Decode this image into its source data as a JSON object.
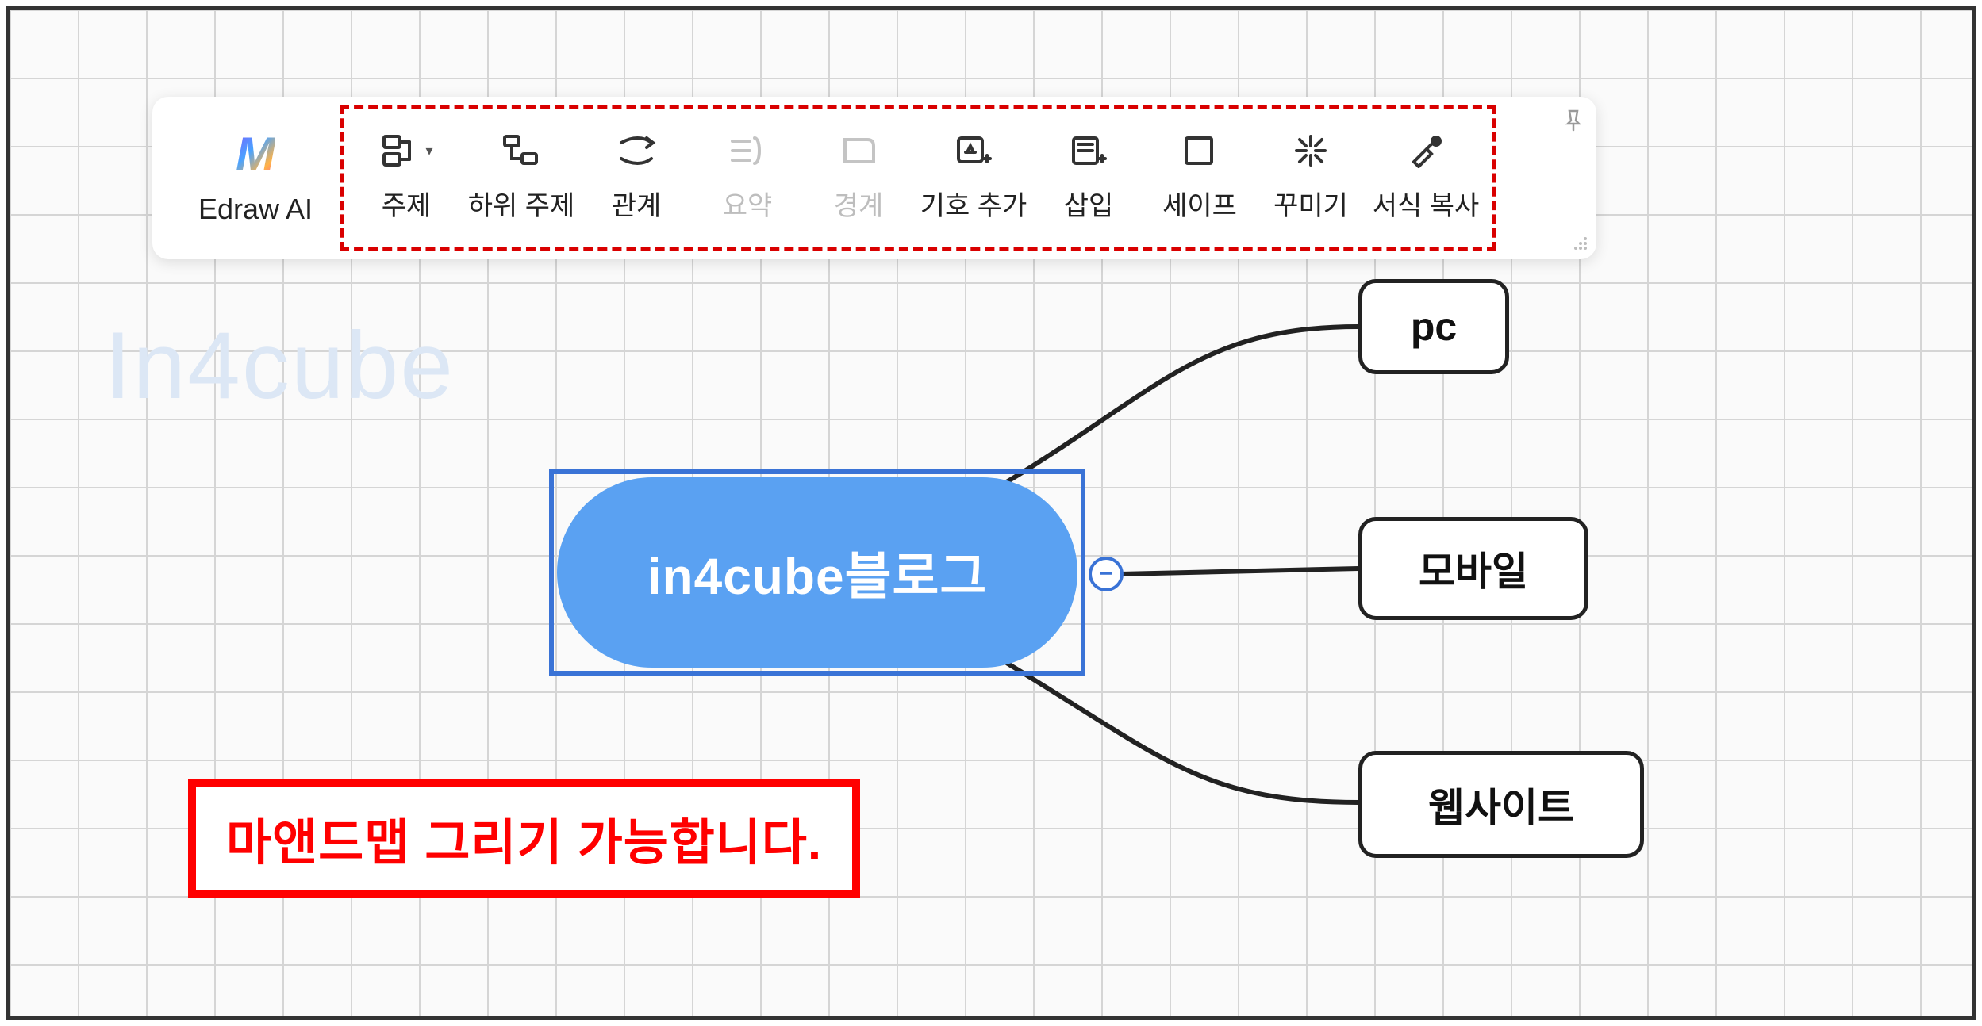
{
  "toolbar": {
    "ai_label": "Edraw AI",
    "items": [
      {
        "label": "주제",
        "disabled": false
      },
      {
        "label": "하위 주제",
        "disabled": false
      },
      {
        "label": "관계",
        "disabled": false
      },
      {
        "label": "요약",
        "disabled": true
      },
      {
        "label": "경계",
        "disabled": true
      },
      {
        "label": "기호 추가",
        "disabled": false
      },
      {
        "label": "삽입",
        "disabled": false
      },
      {
        "label": "세이프",
        "disabled": false
      },
      {
        "label": "꾸미기",
        "disabled": false
      },
      {
        "label": "서식 복사",
        "disabled": false
      }
    ]
  },
  "watermark": "In4cube",
  "mindmap": {
    "central": "in4cube블로그",
    "collapse": "−",
    "children": [
      {
        "label": "pc"
      },
      {
        "label": "모바일"
      },
      {
        "label": "웹사이트"
      }
    ]
  },
  "annotation": "마앤드맵 그리기 가능합니다."
}
